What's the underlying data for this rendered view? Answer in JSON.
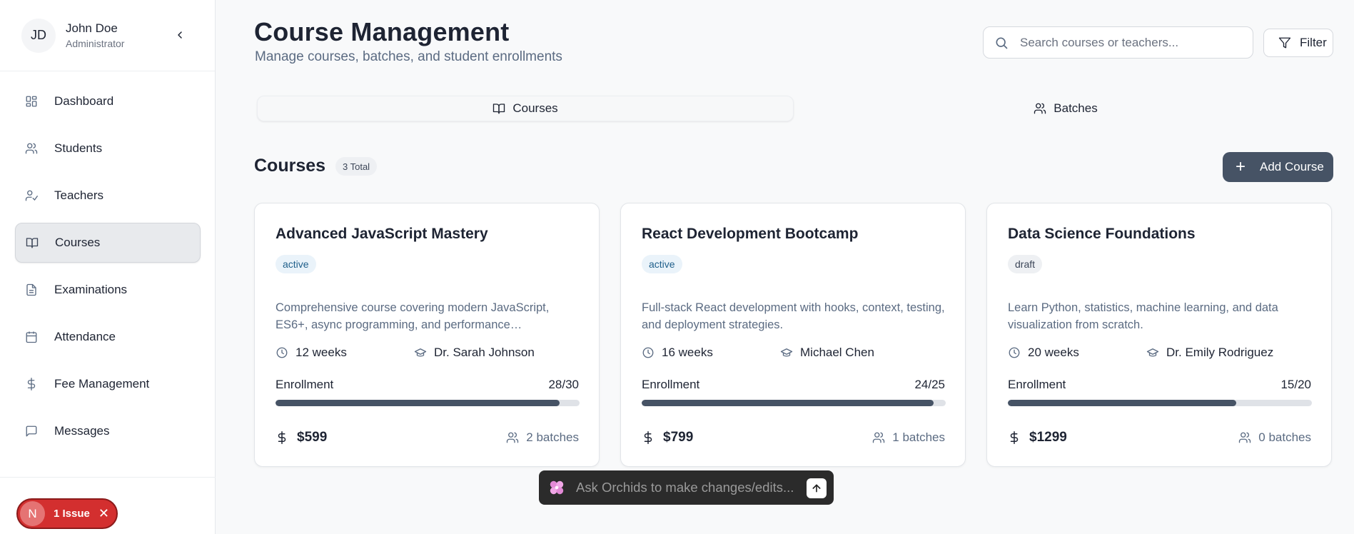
{
  "user": {
    "initials": "JD",
    "name": "John Doe",
    "role": "Administrator"
  },
  "nav": [
    {
      "label": "Dashboard",
      "icon": "grid-icon"
    },
    {
      "label": "Students",
      "icon": "users-icon"
    },
    {
      "label": "Teachers",
      "icon": "user-check-icon"
    },
    {
      "label": "Courses",
      "icon": "book-icon",
      "active": true
    },
    {
      "label": "Examinations",
      "icon": "file-text-icon"
    },
    {
      "label": "Attendance",
      "icon": "calendar-icon"
    },
    {
      "label": "Fee Management",
      "icon": "dollar-icon"
    },
    {
      "label": "Messages",
      "icon": "message-icon"
    }
  ],
  "issue": {
    "letter": "N",
    "label": "1 Issue"
  },
  "header": {
    "title": "Course Management",
    "subtitle": "Manage courses, batches, and student enrollments",
    "search_placeholder": "Search courses or teachers...",
    "filter_label": "Filter"
  },
  "tabs": [
    {
      "label": "Courses",
      "active": true
    },
    {
      "label": "Batches",
      "active": false
    }
  ],
  "section": {
    "title": "Courses",
    "total_label": "3 Total",
    "add_label": "Add Course"
  },
  "courses": [
    {
      "title": "Advanced JavaScript Mastery",
      "status": "active",
      "description": "Comprehensive course covering modern JavaScript, ES6+, async programming, and performance…",
      "duration": "12 weeks",
      "teacher": "Dr. Sarah Johnson",
      "enrollment_label": "Enrollment",
      "enrolled": 28,
      "capacity": 30,
      "enrollment_text": "28/30",
      "price": "$599",
      "batches": "2 batches"
    },
    {
      "title": "React Development Bootcamp",
      "status": "active",
      "description": "Full-stack React development with hooks, context, testing, and deployment strategies.",
      "duration": "16 weeks",
      "teacher": "Michael Chen",
      "enrollment_label": "Enrollment",
      "enrolled": 24,
      "capacity": 25,
      "enrollment_text": "24/25",
      "price": "$799",
      "batches": "1 batches"
    },
    {
      "title": "Data Science Foundations",
      "status": "draft",
      "description": "Learn Python, statistics, machine learning, and data visualization from scratch.",
      "duration": "20 weeks",
      "teacher": "Dr. Emily Rodriguez",
      "enrollment_label": "Enrollment",
      "enrolled": 15,
      "capacity": 20,
      "enrollment_text": "15/20",
      "price": "$1299",
      "batches": "0 batches"
    }
  ],
  "orchids": {
    "placeholder": "Ask Orchids to make changes/edits..."
  },
  "colors": {
    "accent": "#465365",
    "issue": "#d32f2f",
    "badge_active": "#eaf3fa",
    "badge_draft": "#eef0f3"
  }
}
